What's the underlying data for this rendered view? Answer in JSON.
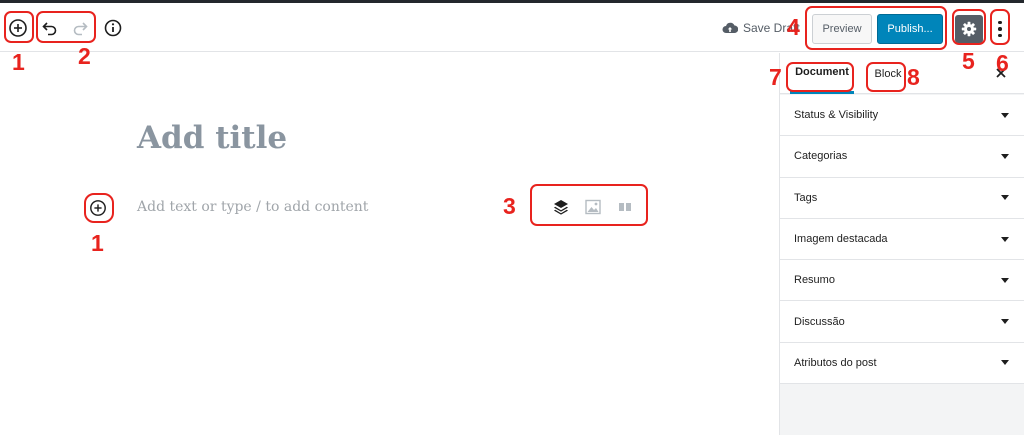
{
  "toolbar": {
    "save_draft": "Save Draft",
    "preview": "Preview",
    "publish": "Publish..."
  },
  "editor": {
    "title_placeholder": "Add title",
    "content_placeholder": "Add text or type / to add content"
  },
  "sidebar": {
    "tabs": [
      {
        "label": "Document",
        "active": true
      },
      {
        "label": "Block",
        "active": false
      }
    ],
    "panels": [
      {
        "label": "Status & Visibility"
      },
      {
        "label": "Categorias"
      },
      {
        "label": "Tags"
      },
      {
        "label": "Imagem destacada"
      },
      {
        "label": "Resumo"
      },
      {
        "label": "Discussão"
      },
      {
        "label": "Atributos do post"
      }
    ]
  },
  "annotations": {
    "n1_top": "1",
    "n2": "2",
    "n1_inline": "1",
    "n3": "3",
    "n4": "4",
    "n5": "5",
    "n6": "6",
    "n7": "7",
    "n8": "8"
  },
  "colors": {
    "accent": "#0085ba",
    "annotation": "#e8231e",
    "settings_bg": "#555d66"
  },
  "icons": [
    "add-block-icon",
    "undo-icon",
    "redo-icon",
    "info-icon",
    "cloud-upload-icon",
    "gear-icon",
    "more-vertical-icon",
    "close-icon",
    "layers-icon",
    "image-icon",
    "columns-icon",
    "chevron-down-icon"
  ]
}
